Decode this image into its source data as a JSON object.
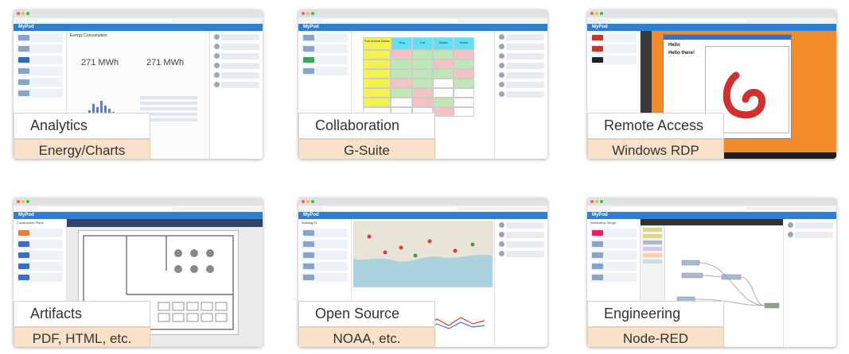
{
  "tiles": [
    {
      "title": "Analytics",
      "subtitle": "Energy/Charts",
      "screen": {
        "app": "MyPod",
        "header": "Energy Consumption",
        "kpi_left": "271 MWh",
        "kpi_right": "271 MWh"
      }
    },
    {
      "title": "Collaboration",
      "subtitle": "G-Suite",
      "screen": {
        "app": "MyPod",
        "cols": [
          "Pod Animal Matrix",
          "Dog",
          "Cat",
          "Snake",
          "Horse"
        ]
      }
    },
    {
      "title": "Remote Access",
      "subtitle": "Windows RDP",
      "screen": {
        "app": "MyPod",
        "doc_line1": "Hello",
        "doc_line2": "Hello there!"
      }
    },
    {
      "title": "Artifacts",
      "subtitle": "PDF, HTML, etc.",
      "screen": {
        "app": "MyPod",
        "header": "Construction Plans"
      }
    },
    {
      "title": "Open Source",
      "subtitle": "NOAA, etc.",
      "screen": {
        "app": "MyPod",
        "header": "Building 01"
      }
    },
    {
      "title": "Engineering",
      "subtitle": "Node-RED",
      "screen": {
        "app": "MyPod",
        "header": "Interesting Things"
      }
    }
  ],
  "colors": {
    "appbar": "#2d7fd3",
    "label_bg": "#f9e0c8",
    "rdp_orange": "#f28c28",
    "sheet_yellow": "#f5f24b",
    "sheet_green": "#bfe6b5",
    "sheet_red": "#f3c2c2"
  }
}
